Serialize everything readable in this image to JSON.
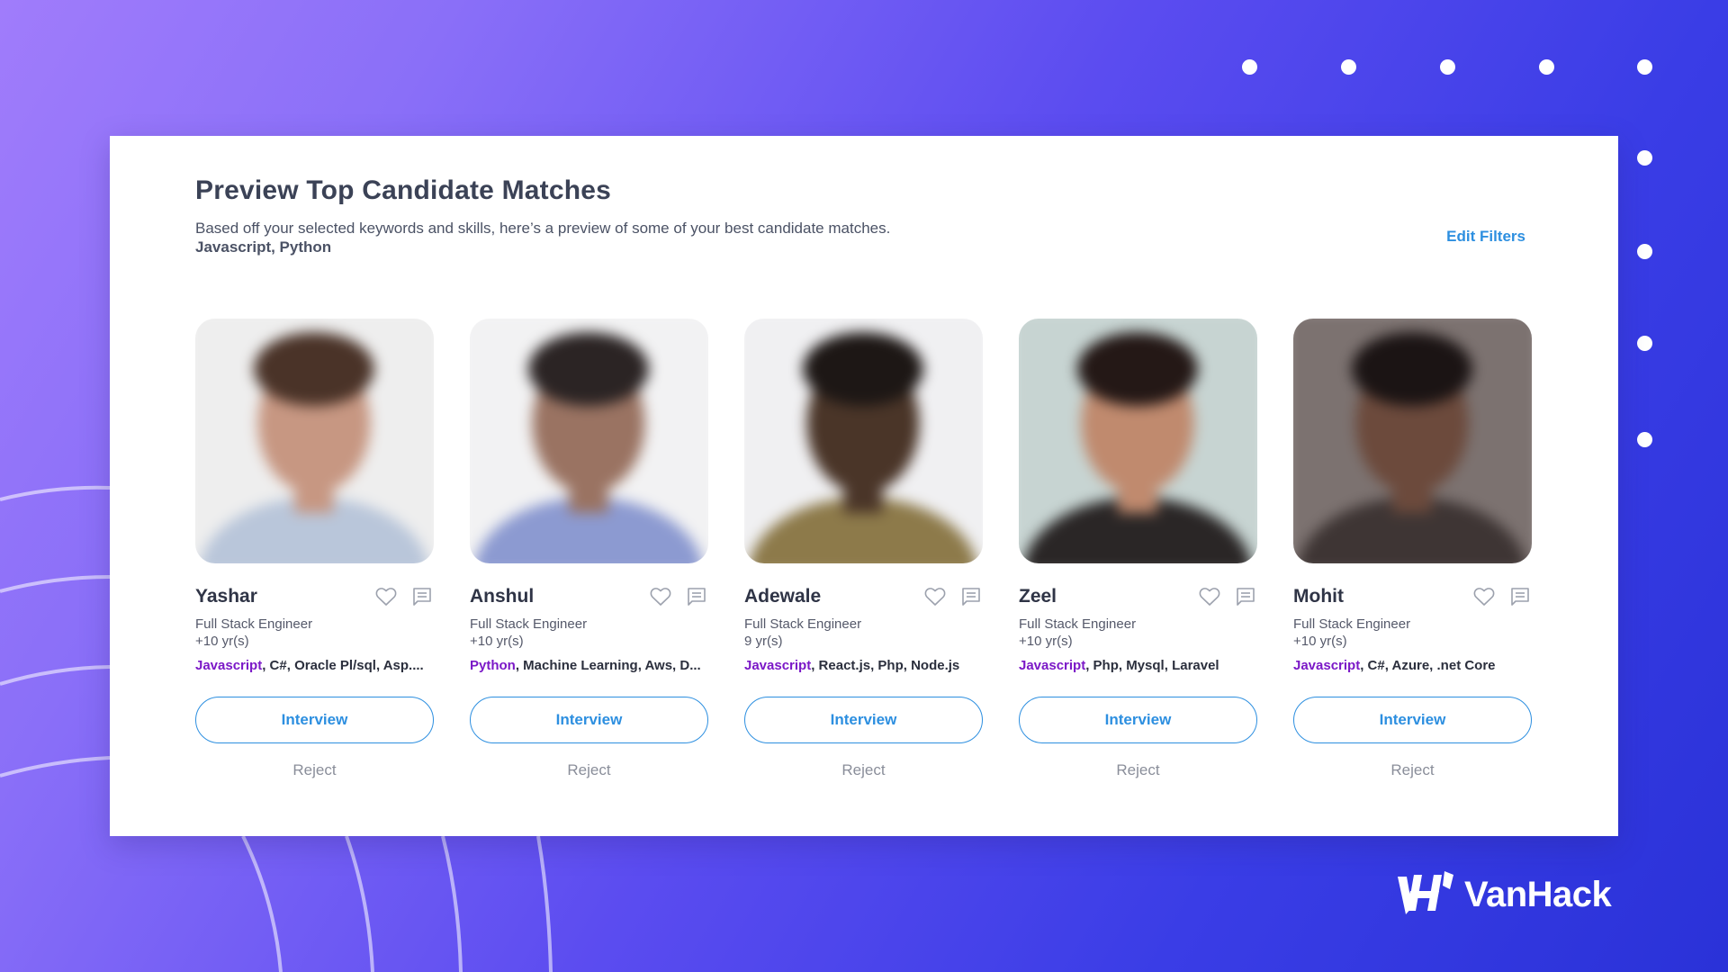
{
  "header": {
    "title": "Preview Top Candidate Matches",
    "subtitle": "Based off your selected keywords and skills, here’s a preview of some of your best candidate matches.",
    "keywords": "Javascript, Python",
    "edit_filters_label": "Edit Filters"
  },
  "candidates": [
    {
      "name": "Yashar",
      "role": "Full Stack Engineer",
      "experience": "+10 yr(s)",
      "primary_skill": "Javascript",
      "other_skills": ", C#, Oracle Pl/sql, Asp....",
      "interview_label": "Interview",
      "reject_label": "Reject",
      "photo_bg": "#eeeeee",
      "skin": "#c79782",
      "hair": "#4a3328",
      "shirt": "#b9c6da"
    },
    {
      "name": "Anshul",
      "role": "Full Stack Engineer",
      "experience": "+10 yr(s)",
      "primary_skill": "Python",
      "other_skills": ", Machine Learning, Aws, D...",
      "interview_label": "Interview",
      "reject_label": "Reject",
      "photo_bg": "#f2f2f3",
      "skin": "#9a7362",
      "hair": "#2b2424",
      "shirt": "#8c9ad1"
    },
    {
      "name": "Adewale",
      "role": "Full Stack Engineer",
      "experience": "9 yr(s)",
      "primary_skill": "Javascript",
      "other_skills": ", React.js, Php, Node.js",
      "interview_label": "Interview",
      "reject_label": "Reject",
      "photo_bg": "#f0f0f2",
      "skin": "#4a3528",
      "hair": "#1d1715",
      "shirt": "#8d7a4a"
    },
    {
      "name": "Zeel",
      "role": "Full Stack Engineer",
      "experience": "+10 yr(s)",
      "primary_skill": "Javascript",
      "other_skills": ", Php, Mysql, Laravel",
      "interview_label": "Interview",
      "reject_label": "Reject",
      "photo_bg": "#c7d4d2",
      "skin": "#c08a6e",
      "hair": "#241816",
      "shirt": "#2a2626"
    },
    {
      "name": "Mohit",
      "role": "Full Stack Engineer",
      "experience": "+10 yr(s)",
      "primary_skill": "Javascript",
      "other_skills": ", C#, Azure, .net Core",
      "interview_label": "Interview",
      "reject_label": "Reject",
      "photo_bg": "#7c7270",
      "skin": "#6c4a3c",
      "hair": "#1b1414",
      "shirt": "#3e3534"
    }
  ],
  "brand": {
    "name": "VanHack"
  },
  "colors": {
    "accent_blue": "#2d8fe0",
    "skill_purple": "#7b18c7",
    "title_gray": "#3b4256"
  }
}
